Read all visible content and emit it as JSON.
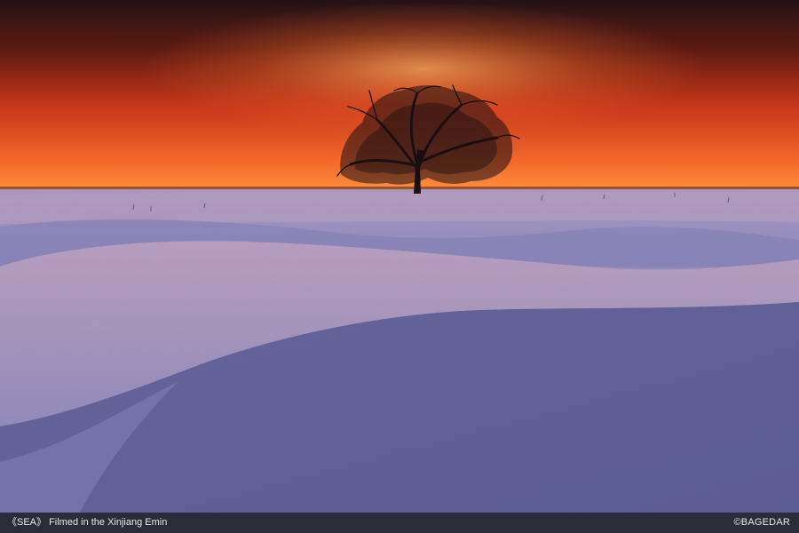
{
  "caption": {
    "left": "《SEA》 Filmed in the Xinjiang Emin",
    "right": "©BAGEDAR"
  },
  "scene": {
    "subject": "tree",
    "colors": {
      "sky_top": "#2a1414",
      "sky_mid": "#e8441c",
      "sky_horizon": "#ff8a3a",
      "snow_light": "#9a98c8",
      "snow_dark": "#4a4a7c",
      "snow_glow": "#d9a3b8"
    }
  }
}
